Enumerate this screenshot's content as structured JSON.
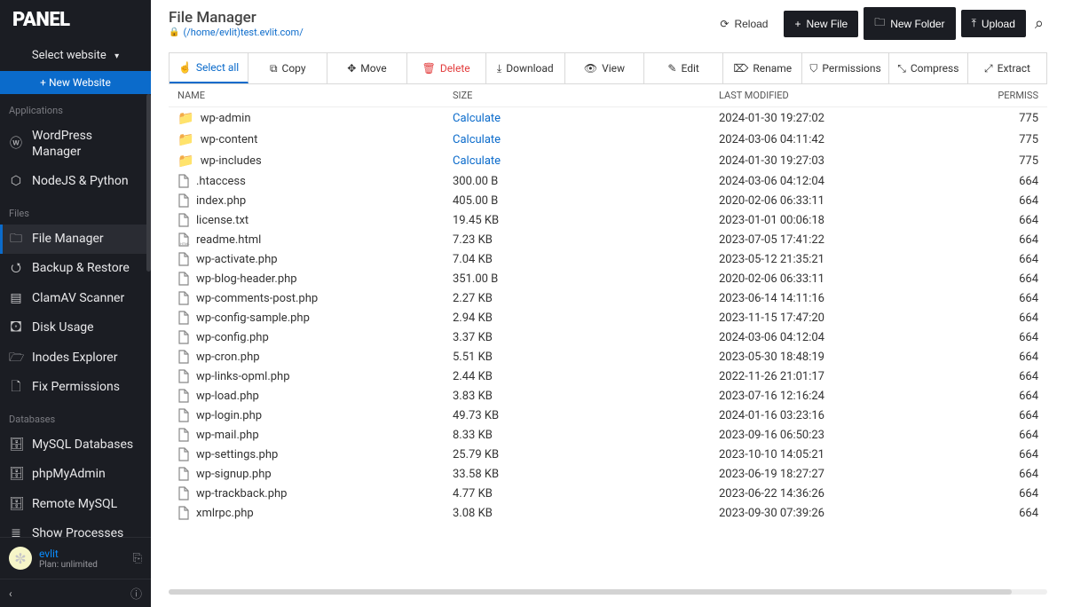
{
  "brand": "PANEL",
  "select_website": "Select website",
  "new_website": "New Website",
  "sections": {
    "applications": "Applications",
    "files": "Files",
    "databases": "Databases"
  },
  "nav": {
    "wordpress": "WordPress Manager",
    "nodejs": "NodeJS & Python",
    "file_manager": "File Manager",
    "backup": "Backup & Restore",
    "clamav": "ClamAV Scanner",
    "disk": "Disk Usage",
    "inodes": "Inodes Explorer",
    "fixperm": "Fix Permissions",
    "mysql": "MySQL Databases",
    "pma": "phpMyAdmin",
    "remote": "Remote MySQL",
    "processes": "Show Processes"
  },
  "user": {
    "name": "evlit",
    "plan": "Plan: unlimited"
  },
  "collapse_label": "‹",
  "page_title": "File Manager",
  "path": "(/home/evlit)test.evlit.com/",
  "actions": {
    "reload": "Reload",
    "new_file": "New File",
    "new_folder": "New Folder",
    "upload": "Upload"
  },
  "toolbar": {
    "select_all": "Select all",
    "copy": "Copy",
    "move": "Move",
    "delete": "Delete",
    "download": "Download",
    "view": "View",
    "edit": "Edit",
    "rename": "Rename",
    "permissions": "Permissions",
    "compress": "Compress",
    "extract": "Extract"
  },
  "columns": {
    "name": "NAME",
    "size": "SIZE",
    "modified": "LAST MODIFIED",
    "perm": "PERMISS"
  },
  "calc_label": "Calculate",
  "rows": [
    {
      "type": "folder",
      "name": "wp-admin",
      "size": "__CALC__",
      "mod": "2024-01-30 19:27:02",
      "perm": "775"
    },
    {
      "type": "folder",
      "name": "wp-content",
      "size": "__CALC__",
      "mod": "2024-03-06 04:11:42",
      "perm": "775"
    },
    {
      "type": "folder",
      "name": "wp-includes",
      "size": "__CALC__",
      "mod": "2024-01-30 19:27:03",
      "perm": "775"
    },
    {
      "type": "file",
      "name": ".htaccess",
      "size": "300.00 B",
      "mod": "2024-03-06 04:12:04",
      "perm": "664"
    },
    {
      "type": "file",
      "name": "index.php",
      "size": "405.00 B",
      "mod": "2020-02-06 06:33:11",
      "perm": "664"
    },
    {
      "type": "file",
      "name": "license.txt",
      "size": "19.45 KB",
      "mod": "2023-01-01 00:06:18",
      "perm": "664"
    },
    {
      "type": "html",
      "name": "readme.html",
      "size": "7.23 KB",
      "mod": "2023-07-05 17:41:22",
      "perm": "664"
    },
    {
      "type": "file",
      "name": "wp-activate.php",
      "size": "7.04 KB",
      "mod": "2023-05-12 21:35:21",
      "perm": "664"
    },
    {
      "type": "file",
      "name": "wp-blog-header.php",
      "size": "351.00 B",
      "mod": "2020-02-06 06:33:11",
      "perm": "664"
    },
    {
      "type": "file",
      "name": "wp-comments-post.php",
      "size": "2.27 KB",
      "mod": "2023-06-14 14:11:16",
      "perm": "664"
    },
    {
      "type": "file",
      "name": "wp-config-sample.php",
      "size": "2.94 KB",
      "mod": "2023-11-15 17:47:20",
      "perm": "664"
    },
    {
      "type": "file",
      "name": "wp-config.php",
      "size": "3.37 KB",
      "mod": "2024-03-06 04:12:04",
      "perm": "664"
    },
    {
      "type": "file",
      "name": "wp-cron.php",
      "size": "5.51 KB",
      "mod": "2023-05-30 18:48:19",
      "perm": "664"
    },
    {
      "type": "file",
      "name": "wp-links-opml.php",
      "size": "2.44 KB",
      "mod": "2022-11-26 21:01:17",
      "perm": "664"
    },
    {
      "type": "file",
      "name": "wp-load.php",
      "size": "3.83 KB",
      "mod": "2023-07-16 12:16:24",
      "perm": "664"
    },
    {
      "type": "file",
      "name": "wp-login.php",
      "size": "49.73 KB",
      "mod": "2024-01-16 03:23:16",
      "perm": "664"
    },
    {
      "type": "file",
      "name": "wp-mail.php",
      "size": "8.33 KB",
      "mod": "2023-09-16 06:50:23",
      "perm": "664"
    },
    {
      "type": "file",
      "name": "wp-settings.php",
      "size": "25.79 KB",
      "mod": "2023-10-10 14:05:21",
      "perm": "664"
    },
    {
      "type": "file",
      "name": "wp-signup.php",
      "size": "33.58 KB",
      "mod": "2023-06-19 18:27:27",
      "perm": "664"
    },
    {
      "type": "file",
      "name": "wp-trackback.php",
      "size": "4.77 KB",
      "mod": "2023-06-22 14:36:26",
      "perm": "664"
    },
    {
      "type": "file",
      "name": "xmlrpc.php",
      "size": "3.08 KB",
      "mod": "2023-09-30 07:39:26",
      "perm": "664"
    }
  ]
}
